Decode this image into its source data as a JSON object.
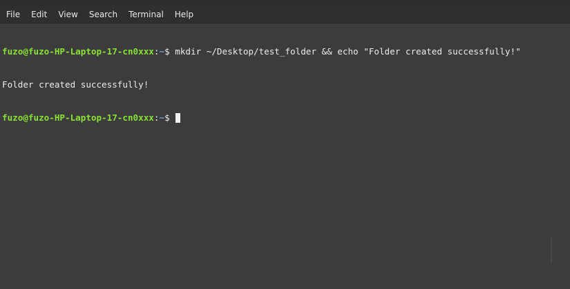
{
  "menu": {
    "file": "File",
    "edit": "Edit",
    "view": "View",
    "search": "Search",
    "terminal": "Terminal",
    "help": "Help"
  },
  "terminal": {
    "prompt_user": "fuzo@fuzo-HP-Laptop-17-cn0xxx",
    "prompt_colon": ":",
    "prompt_path": "~",
    "prompt_symbol": "$ ",
    "command": "mkdir ~/Desktop/test_folder && echo \"Folder created successfully!\"",
    "output": "Folder created successfully!"
  },
  "colors": {
    "background": "#3c3c3c",
    "menubar": "#2f2f2f",
    "prompt_user": "#8ae234",
    "prompt_path": "#729fcf",
    "text": "#ececec"
  }
}
